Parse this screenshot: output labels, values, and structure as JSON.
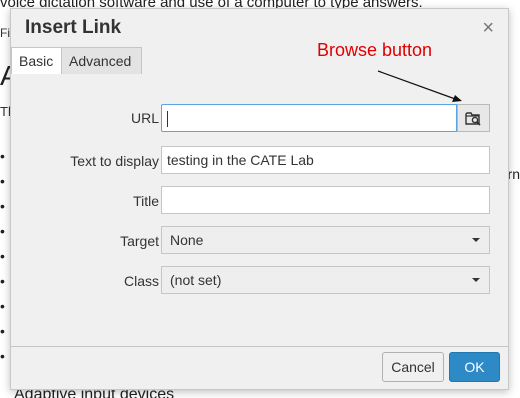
{
  "background": {
    "top_text": "voice dictation software and use of a computer to type answers.",
    "fragment_fi": "Fi",
    "fragment_a": "A",
    "fragment_th": "Th",
    "fragment_rn": "rn",
    "bullet_char": "•",
    "bottom_text": "Adaptive input devices"
  },
  "dialog": {
    "title": "Insert Link",
    "close_glyph": "×",
    "tabs": [
      {
        "label": "Basic",
        "active": true
      },
      {
        "label": "Advanced",
        "active": false
      }
    ],
    "fields": {
      "url": {
        "label": "URL",
        "value": ""
      },
      "text_to_display": {
        "label": "Text to display",
        "value": "testing in the CATE Lab"
      },
      "title": {
        "label": "Title",
        "value": ""
      },
      "target": {
        "label": "Target",
        "value": "None"
      },
      "class": {
        "label": "Class",
        "value": "(not set)"
      }
    },
    "browse_icon": "folder-search-icon",
    "annotation": {
      "text": "Browse button",
      "color": "#e00000"
    },
    "buttons": {
      "cancel": "Cancel",
      "ok": "OK"
    },
    "colors": {
      "ok_button": "#2d8ac7",
      "focus_border": "#59a5e5"
    }
  }
}
